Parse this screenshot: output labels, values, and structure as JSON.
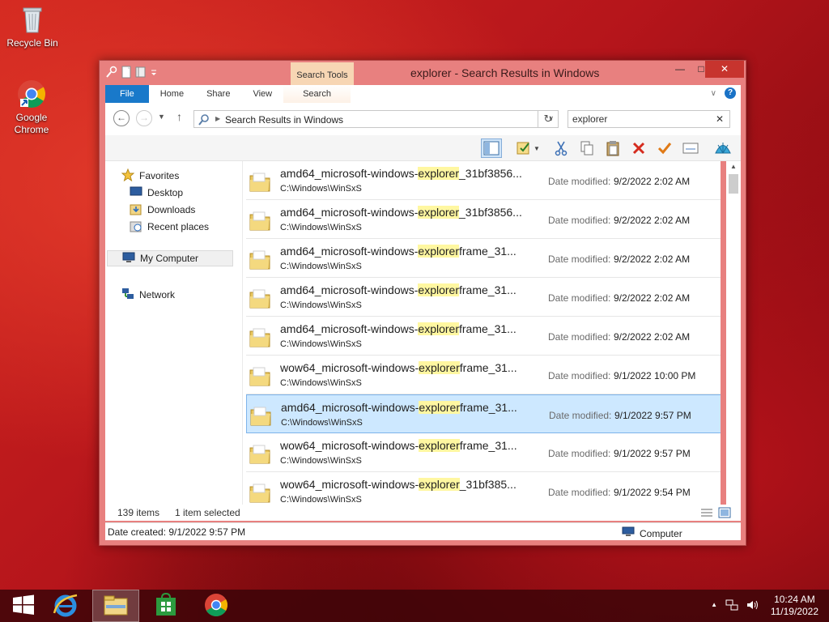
{
  "desktop": {
    "icons": [
      {
        "label": "Recycle Bin"
      },
      {
        "label": "Google Chrome"
      }
    ]
  },
  "window": {
    "title": "explorer - Search Results in Windows",
    "context_tab": "Search Tools",
    "tabs": [
      "File",
      "Home",
      "Share",
      "View",
      "Search"
    ],
    "minimize_glyph": "—",
    "maximize_glyph": "□",
    "close_glyph": "✕",
    "help_glyph": "?",
    "collapse_glyph": "∨"
  },
  "address": {
    "breadcrumb": "Search Results in Windows",
    "back_glyph": "←",
    "forward_glyph": "→",
    "up_glyph": "↑",
    "refresh_glyph": "↻",
    "dropdown_glyph": "∨"
  },
  "search": {
    "value": "explorer",
    "clear_glyph": "✕"
  },
  "nav": {
    "favorites": "Favorites",
    "desktop": "Desktop",
    "downloads": "Downloads",
    "recent": "Recent places",
    "computer": "My Computer",
    "network": "Network"
  },
  "results": {
    "date_label": "Date modified:",
    "rows": [
      {
        "prefix": "amd64_microsoft-windows-",
        "match": "explorer",
        "suffix": "_31bf3856...",
        "path": "C:\\Windows\\WinSxS",
        "date": "9/2/2022 2:02 AM",
        "selected": false
      },
      {
        "prefix": "amd64_microsoft-windows-",
        "match": "explorer",
        "suffix": "_31bf3856...",
        "path": "C:\\Windows\\WinSxS",
        "date": "9/2/2022 2:02 AM",
        "selected": false
      },
      {
        "prefix": "amd64_microsoft-windows-",
        "match": "explorer",
        "suffix": "frame_31...",
        "path": "C:\\Windows\\WinSxS",
        "date": "9/2/2022 2:02 AM",
        "selected": false
      },
      {
        "prefix": "amd64_microsoft-windows-",
        "match": "explorer",
        "suffix": "frame_31...",
        "path": "C:\\Windows\\WinSxS",
        "date": "9/2/2022 2:02 AM",
        "selected": false
      },
      {
        "prefix": "amd64_microsoft-windows-",
        "match": "explorer",
        "suffix": "frame_31...",
        "path": "C:\\Windows\\WinSxS",
        "date": "9/2/2022 2:02 AM",
        "selected": false
      },
      {
        "prefix": "wow64_microsoft-windows-",
        "match": "explorer",
        "suffix": "frame_31...",
        "path": "C:\\Windows\\WinSxS",
        "date": "9/1/2022 10:00 PM",
        "selected": false
      },
      {
        "prefix": "amd64_microsoft-windows-",
        "match": "explorer",
        "suffix": "frame_31...",
        "path": "C:\\Windows\\WinSxS",
        "date": "9/1/2022 9:57 PM",
        "selected": true
      },
      {
        "prefix": "wow64_microsoft-windows-",
        "match": "explorer",
        "suffix": "frame_31...",
        "path": "C:\\Windows\\WinSxS",
        "date": "9/1/2022 9:57 PM",
        "selected": false
      },
      {
        "prefix": "wow64_microsoft-windows-",
        "match": "explorer",
        "suffix": "_31bf385...",
        "path": "C:\\Windows\\WinSxS",
        "date": "9/1/2022 9:54 PM",
        "selected": false
      }
    ]
  },
  "status": {
    "item_count": "139 items",
    "selection": "1 item selected"
  },
  "details": {
    "date_created": "Date created: 9/1/2022 9:57 PM",
    "location": "Computer"
  },
  "taskbar": {
    "time": "10:24 AM",
    "date": "11/19/2022",
    "tray_arrow": "▲"
  },
  "colors": {
    "accent": "#1979ca",
    "window_frame": "#e8807f",
    "close_button": "#c7342e",
    "selection": "#cde8ff",
    "highlight": "#fff7a1"
  }
}
